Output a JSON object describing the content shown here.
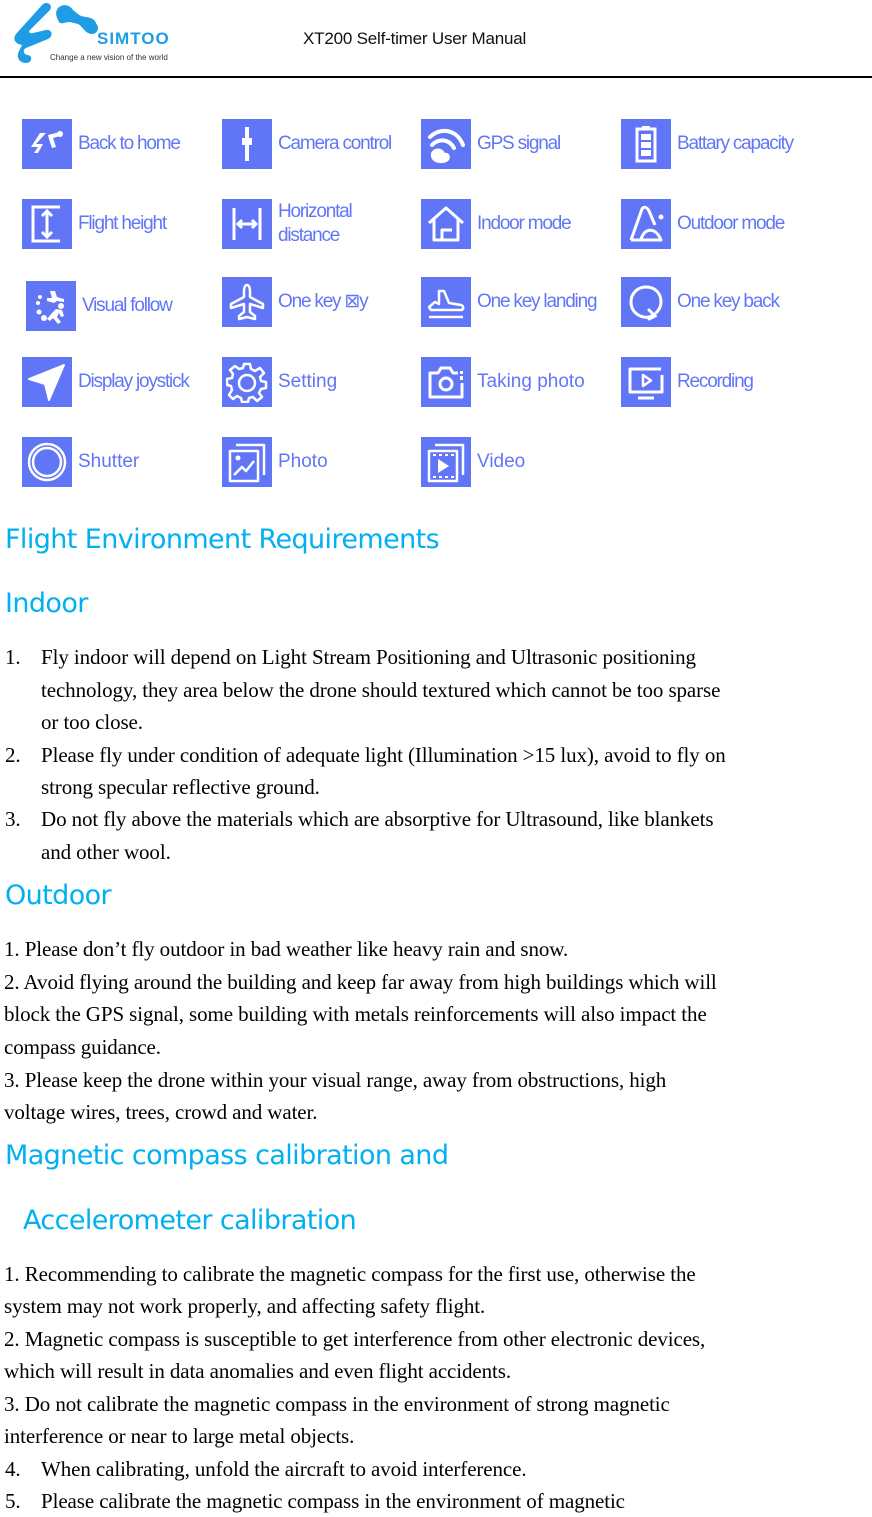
{
  "header": {
    "brand": "SIMTOO",
    "tagline": "Change a new vision of the world",
    "title": "XT200 Self-timer User Manual"
  },
  "colors": {
    "icon_blue": "#6176f7",
    "heading_blue": "#00b0f0",
    "brand_blue": "#1e9de6"
  },
  "icons": [
    {
      "icon": "back-to-home-icon",
      "label": "Back to home"
    },
    {
      "icon": "camera-control-icon",
      "label": "Camera control"
    },
    {
      "icon": "gps-signal-icon",
      "label": "GPS signal"
    },
    {
      "icon": "battery-icon",
      "label": "Battary capacity"
    },
    {
      "icon": "flight-height-icon",
      "label": "Flight height"
    },
    {
      "icon": "horizontal-distance-icon",
      "label": "Horizontal distance"
    },
    {
      "icon": "indoor-mode-icon",
      "label": "Indoor mode"
    },
    {
      "icon": "outdoor-mode-icon",
      "label": "Outdoor mode"
    },
    {
      "icon": "visual-follow-icon",
      "label": "Visual follow"
    },
    {
      "icon": "airplane-takeoff-icon",
      "label": "One key ⊠y"
    },
    {
      "icon": "landing-icon",
      "label": "One key landing"
    },
    {
      "icon": "return-icon",
      "label": "One key back"
    },
    {
      "icon": "joystick-arrow-icon",
      "label": "Display joystick"
    },
    {
      "icon": "gear-icon",
      "label": "Setting"
    },
    {
      "icon": "camera-icon",
      "label": "Taking photo"
    },
    {
      "icon": "recording-icon",
      "label": "Recording"
    },
    {
      "icon": "shutter-icon",
      "label": "Shutter"
    },
    {
      "icon": "photo-gallery-icon",
      "label": "Photo"
    },
    {
      "icon": "video-gallery-icon",
      "label": "Video"
    }
  ],
  "icon_labels": {
    "horizontal_line1": "Horizontal",
    "horizontal_line2": "distance"
  },
  "sections": {
    "flight_env_title": "Flight Environment Requirements",
    "indoor_title": "Indoor",
    "indoor_items": [
      {
        "num": "1.",
        "lines": [
          "Fly indoor will depend on Light Stream Positioning and Ultrasonic positioning",
          "technology, they area below the drone should textured which cannot be too sparse",
          "or too close."
        ]
      },
      {
        "num": "2.",
        "lines": [
          "Please fly under condition of adequate light (Illumination >15 lux), avoid to fly on",
          "strong specular reflective ground."
        ]
      },
      {
        "num": "3.",
        "lines": [
          "Do not fly above the materials which are absorptive for Ultrasound, like blankets",
          "and other wool."
        ]
      }
    ],
    "outdoor_title": "Outdoor",
    "outdoor_lines": [
      "1. Please don’t fly outdoor in bad weather like heavy rain and snow.",
      "2. Avoid flying around the building and keep far away from high buildings which will",
      "block the GPS signal, some building with metals reinforcements will also impact the",
      "compass guidance.",
      "3. Please keep the drone within your visual range, away from obstructions, high",
      "voltage wires, trees, crowd and water."
    ],
    "calibration_title_line1": "Magnetic compass calibration and",
    "calibration_title_line2": "Accelerometer calibration",
    "calibration_lines": [
      "1. Recommending to calibrate the magnetic compass for the first use, otherwise the",
      "system may not work properly, and affecting safety flight.",
      "2. Magnetic compass is susceptible to get interference from other electronic devices,",
      "which will result in data anomalies and even flight accidents.",
      "3. Do not calibrate the magnetic compass in the environment of strong magnetic",
      "interference or near to large metal objects."
    ],
    "calibration_numbered": [
      {
        "num": "4.",
        "text": "When calibrating, unfold the aircraft to avoid interference."
      },
      {
        "num": "5.",
        "text": "Please calibrate the magnetic compass in the environment of magnetic"
      }
    ]
  }
}
